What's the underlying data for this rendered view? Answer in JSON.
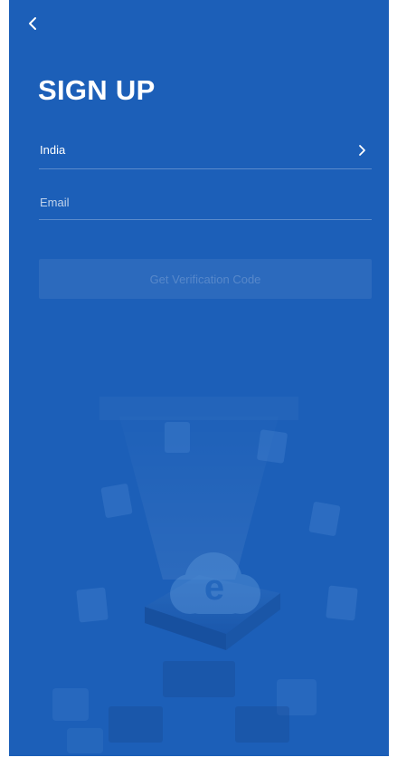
{
  "header": {
    "back_icon": "chevron-left-icon",
    "title": "SIGN UP"
  },
  "form": {
    "country": {
      "value": "India",
      "icon": "chevron-right-icon"
    },
    "email": {
      "placeholder": "Email",
      "value": ""
    },
    "submit_label": "Get Verification Code"
  },
  "illustration": {
    "icon": "cloud-email-illustration"
  },
  "colors": {
    "background": "#1c5fb8",
    "text": "#ffffff",
    "divider": "rgba(255,255,255,0.28)",
    "button_disabled_bg": "rgba(255,255,255,0.07)"
  }
}
